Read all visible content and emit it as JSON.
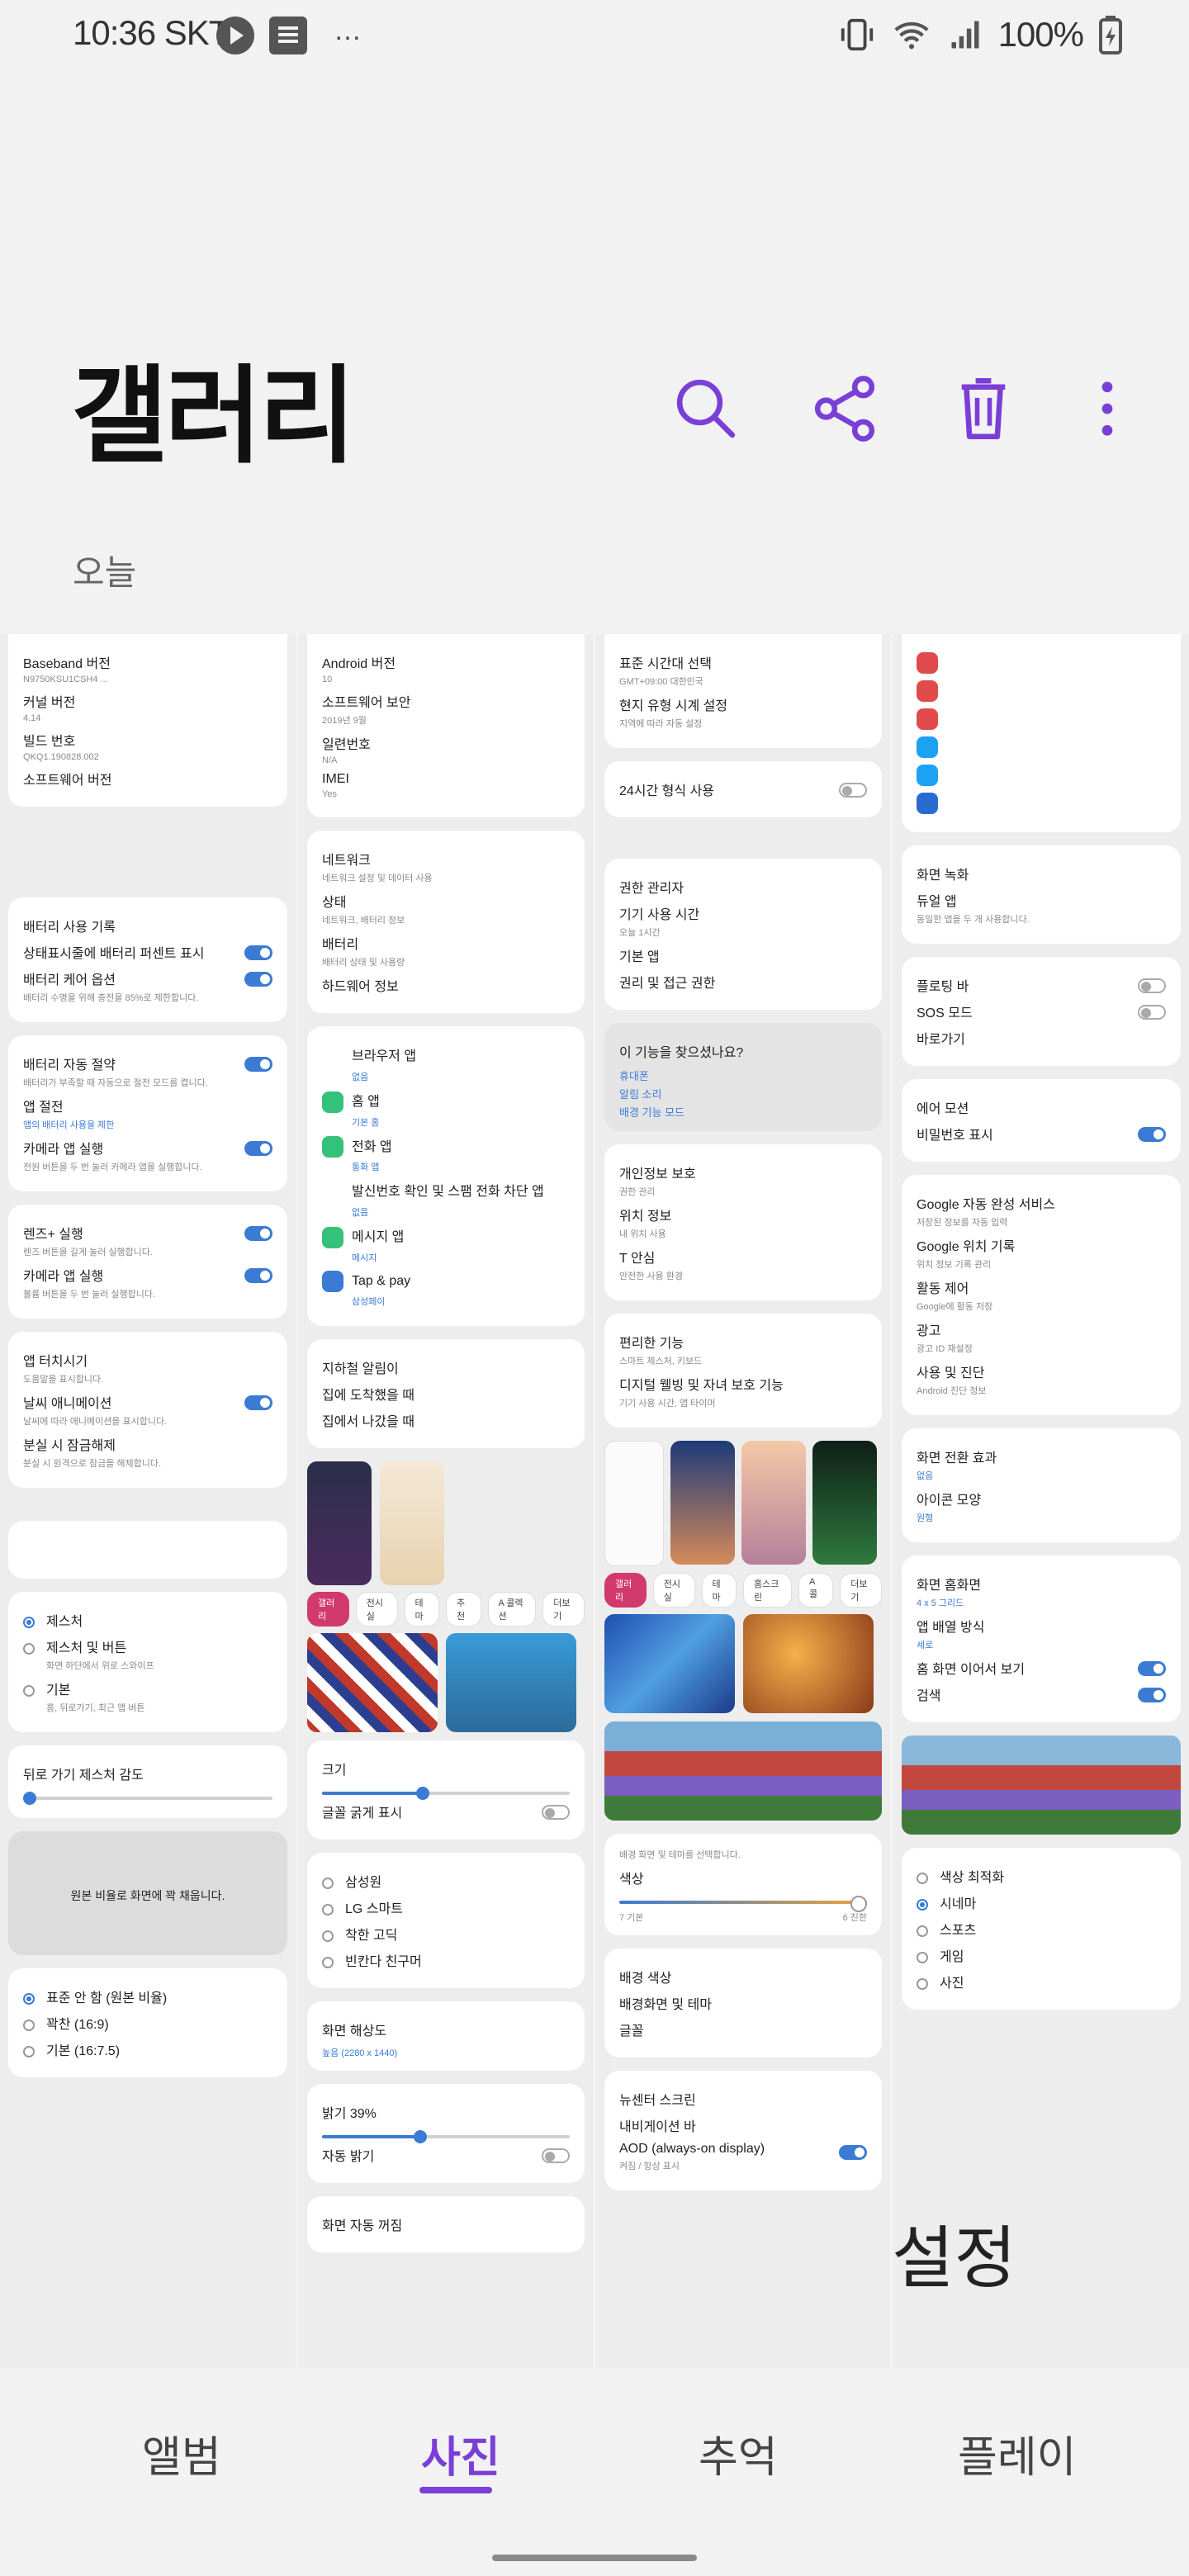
{
  "status_bar": {
    "time_carrier": "10:36 SKT",
    "more": "…",
    "battery": "100%"
  },
  "header": {
    "title": "갤러리",
    "actions": [
      "search-icon",
      "share-icon",
      "delete-icon",
      "more-icon"
    ]
  },
  "section": {
    "label": "오늘"
  },
  "colors": {
    "accent": "#7a3fd6",
    "toggle_blue": "#3b7bd4",
    "chip_pink": "#d23a6d"
  },
  "col1": {
    "card1": [
      {
        "t": "Baseband 버전",
        "s": "N9750KSU1CSH4 ...",
        "sm": true
      },
      {
        "t": "커널 버전",
        "s": "4.14"
      },
      {
        "t": "빌드 번호",
        "s": "QKQ1.190828.002"
      },
      {
        "t": "소프트웨어 버전",
        "s": ""
      }
    ],
    "card2": [
      {
        "t": "배터리 사용 기록"
      },
      {
        "t": "상태표시줄에 배터리 퍼센트 표시",
        "tog": true
      },
      {
        "t": "배터리 케어 옵션",
        "s": "배터리 수명을 위해 충전을 85%로 제한합니다.",
        "tog": true
      }
    ],
    "card3": [
      {
        "t": "배터리 자동 절약",
        "s": "배터리가 부족할 때 자동으로 절전 모드를 켭니다.",
        "tog": true
      },
      {
        "t": "앱 절전",
        "s": "앱의 배터리 사용을 제한",
        "blue": true
      },
      {
        "t": "카메라 앱 실행",
        "s": "전원 버튼을 두 번 눌러 카메라 앱을 실행합니다.",
        "tog": true
      }
    ],
    "card4": [
      {
        "t": "렌즈+ 실행",
        "s": "렌즈 버튼을 길게 눌러 실행합니다.",
        "tog": true
      },
      {
        "t": "카메라 앱 실행",
        "s": "볼륨 버튼을 두 번 눌러 실행합니다.",
        "tog": true
      }
    ],
    "card5": [
      {
        "t": "앱 터치시기",
        "s": "도움말을 표시합니다."
      },
      {
        "t": "날씨 애니메이션",
        "s": "날씨에 따라 애니메이션을 표시합니다.",
        "tog": true
      },
      {
        "t": "분실 시 잠금해제",
        "s": "분실 시 원격으로 잠금을 해제합니다."
      }
    ],
    "radios": [
      {
        "t": "제스처",
        "on": true
      },
      {
        "t": "제스처 및 버튼",
        "s": "화면 하단에서 위로 스와이프"
      },
      {
        "t": "기본",
        "s": "홈, 뒤로가기, 최근 앱 버튼"
      }
    ],
    "gesture_label": "뒤로 가기 제스처 감도",
    "preview_text": "원본 비율로 화면에 꽉 채웁니다.",
    "ratio_radios": [
      {
        "t": "표준 안 함 (원본 비율)",
        "on": true
      },
      {
        "t": "꽉찬 (16:9)"
      },
      {
        "t": "기본 (16:7.5)"
      }
    ]
  },
  "col2": {
    "card1": [
      {
        "t": "Android 버전",
        "s": "10"
      },
      {
        "t": "소프트웨어 보안",
        "s": "2019년 9월"
      },
      {
        "t": "일련번호",
        "s": "N/A"
      },
      {
        "t": "IMEI",
        "s": "Yes"
      }
    ],
    "card2": [
      {
        "t": "네트워크",
        "s": "네트워크 설정 및 데이터 사용"
      },
      {
        "t": "상태",
        "s": "네트워크, 배터리 정보"
      },
      {
        "t": "배터리",
        "s": "배터리 상태 및 사용량"
      },
      {
        "t": "하드웨어 정보"
      }
    ],
    "apps": [
      {
        "t": "브라우저 앱",
        "s": "없음",
        "c": "#ffffff"
      },
      {
        "t": "홈 앱",
        "s": "기본 홈",
        "c": "#34c17a"
      },
      {
        "t": "전화 앱",
        "s": "통화 앱",
        "c": "#34c17a"
      },
      {
        "t": "발신번호 확인 및 스팸 전화 차단 앱",
        "s": "없음",
        "c": "#ffffff"
      },
      {
        "t": "메시지 앱",
        "s": "메시지",
        "c": "#34c17a"
      },
      {
        "t": "Tap & pay",
        "s": "삼성페이",
        "c": "#3b7bd4"
      }
    ],
    "card3": [
      {
        "t": "지하철 알림이",
        "s": ""
      },
      {
        "t": "집에 도착했을 때",
        "s": ""
      },
      {
        "t": "집에서 나갔을 때",
        "s": ""
      }
    ],
    "chips": [
      "갤러리",
      "전시실",
      "테마",
      "추천",
      "A 콜렉션",
      "더보기"
    ],
    "size_label": "크기",
    "bold_label": "글꼴 굵게 표시",
    "font_radios": [
      "삼성원",
      "LG 스마트",
      "착한 고딕",
      "빈칸다 친구머"
    ],
    "resolution_label": "화면 해상도",
    "resolution_sub": "높음 (2280 x 1440)",
    "brightness_label": "밝기 39%",
    "auto_brightness": "자동 밝기",
    "screen_label": "화면 자동 꺼짐"
  },
  "col3": {
    "card1": [
      {
        "t": "표준 시간대 선택",
        "s": "GMT+09:00 대한민국"
      },
      {
        "t": "현지 유형 시계 설정",
        "s": "지역에 따라 자동 설정"
      }
    ],
    "hour24": "24시간 형식 사용",
    "card2": [
      {
        "t": "권한 관리자"
      },
      {
        "t": "기기 사용 시간",
        "s": "오늘 1시간"
      },
      {
        "t": "기본 앱"
      },
      {
        "t": "권리 및 접근 권한"
      }
    ],
    "suggestion_title": "이 기능을 찾으셨나요?",
    "suggestion_links": [
      "휴대폰",
      "알림 소리",
      "배경 기능 모드"
    ],
    "card3": [
      {
        "t": "개인정보 보호",
        "s": "권한 관리"
      },
      {
        "t": "위치 정보",
        "s": "내 위치 사용"
      },
      {
        "t": "T 안심",
        "s": "안전한 사용 환경"
      }
    ],
    "card4": [
      {
        "t": "편리한 기능",
        "s": "스마트 제스처, 키보드"
      },
      {
        "t": "디지털 웰빙 및 자녀 보호 기능",
        "s": "기기 사용 시간, 앱 타이머"
      }
    ],
    "chips": [
      "갤러리",
      "전시실",
      "테마",
      "홈스크린",
      "A 콜",
      "더보기"
    ],
    "wallpaper_text": "배경 화면 및 테마를 선택합니다.",
    "font_label": "색상",
    "slider_ends": [
      "7 기본",
      "6 진한"
    ],
    "style_label": "배경 색상",
    "style_rows": [
      "배경화면 및 테마",
      "글꼴"
    ],
    "screen_title": "뉴센터 스크린",
    "screen_rows": [
      {
        "t": "내비게이션 바"
      },
      {
        "t": "AOD (always-on display)",
        "s": "켜짐 / 항상 표시",
        "tog": true
      }
    ]
  },
  "col4": {
    "icons": [
      "#e14b4b",
      "#e14b4b",
      "#e14b4b",
      "#1da1f2",
      "#1da1f2",
      "#2a6bd0"
    ],
    "card1": [
      {
        "t": "화면 녹화"
      },
      {
        "t": "듀얼 앱",
        "s": "동일한 앱을 두 개 사용합니다."
      }
    ],
    "card2": [
      {
        "t": "플로팅 바",
        "tog_off": true
      },
      {
        "t": "SOS 모드",
        "tog_off": true
      },
      {
        "t": "바로가기"
      }
    ],
    "card3": [
      {
        "t": "에어 모션"
      },
      {
        "t": "비밀번호 표시",
        "tog": true
      }
    ],
    "card4": [
      {
        "t": "Google 자동 완성 서비스",
        "s": "저장된 정보를 자동 입력"
      },
      {
        "t": "Google 위치 기록",
        "s": "위치 정보 기록 관리"
      },
      {
        "t": "활동 제어",
        "s": "Google에 활동 저장"
      },
      {
        "t": "광고",
        "s": "광고 ID 재설정"
      },
      {
        "t": "사용 및 진단",
        "s": "Android 진단 정보"
      }
    ],
    "card5": [
      {
        "t": "화면 전환 효과",
        "s": "없음",
        "blue": true
      },
      {
        "t": "아이콘 모양",
        "s": "원형",
        "blue": true
      }
    ],
    "card6": [
      {
        "t": "화면 홈화면",
        "s": "4 x 5 그리드",
        "blue": true
      },
      {
        "t": "앱 배열 방식",
        "s": "세로",
        "blue": true
      },
      {
        "t": "홈 화면 이어서 보기",
        "tog": true
      },
      {
        "t": "검색",
        "tog": true
      }
    ],
    "radios": [
      {
        "t": "색상 최적화"
      },
      {
        "t": "시네마",
        "on": true
      },
      {
        "t": "스포츠"
      },
      {
        "t": "게임"
      },
      {
        "t": "사진"
      }
    ],
    "settings_partial": "설정"
  },
  "bottom_nav": {
    "tabs": [
      "앨범",
      "사진",
      "추억",
      "플레이"
    ],
    "active": 1
  }
}
